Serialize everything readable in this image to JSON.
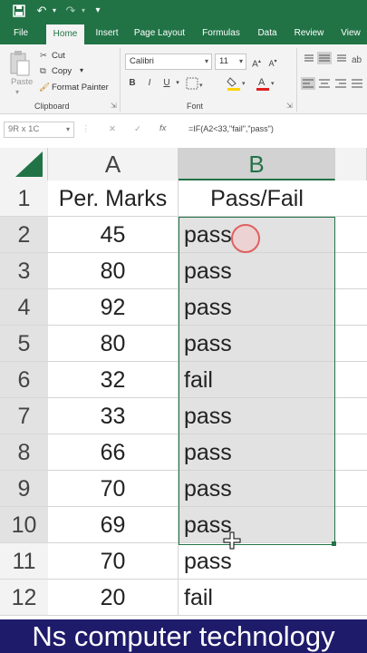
{
  "tabs": [
    "File",
    "Home",
    "Insert",
    "Page Layout",
    "Formulas",
    "Data",
    "Review",
    "View"
  ],
  "active_tab": "Home",
  "clipboard": {
    "cut": "Cut",
    "copy": "Copy",
    "format_painter": "Format Painter",
    "group": "Clipboard"
  },
  "font": {
    "name": "Calibri",
    "size": "11",
    "group": "Font"
  },
  "name_box": "9R x 1C",
  "formula": "=IF(A2<33,\"fail\",\"pass\")",
  "fx_label": "fx",
  "columns": [
    "A",
    "B"
  ],
  "rows": [
    {
      "num": "1",
      "a": "Per. Marks",
      "b": "Pass/Fail",
      "header": true
    },
    {
      "num": "2",
      "a": "45",
      "b": "pass"
    },
    {
      "num": "3",
      "a": "80",
      "b": "pass"
    },
    {
      "num": "4",
      "a": "92",
      "b": "pass"
    },
    {
      "num": "5",
      "a": "80",
      "b": "pass"
    },
    {
      "num": "6",
      "a": "32",
      "b": "fail"
    },
    {
      "num": "7",
      "a": "33",
      "b": "pass"
    },
    {
      "num": "8",
      "a": "66",
      "b": "pass"
    },
    {
      "num": "9",
      "a": "70",
      "b": "pass"
    },
    {
      "num": "10",
      "a": "69",
      "b": "pass"
    },
    {
      "num": "11",
      "a": "70",
      "b": "pass"
    },
    {
      "num": "12",
      "a": "20",
      "b": "fail"
    }
  ],
  "banner": "Ns computer technology",
  "colors": {
    "brand": "#217346",
    "selection": "#e2e2e2",
    "banner": "#1f1b6b"
  }
}
